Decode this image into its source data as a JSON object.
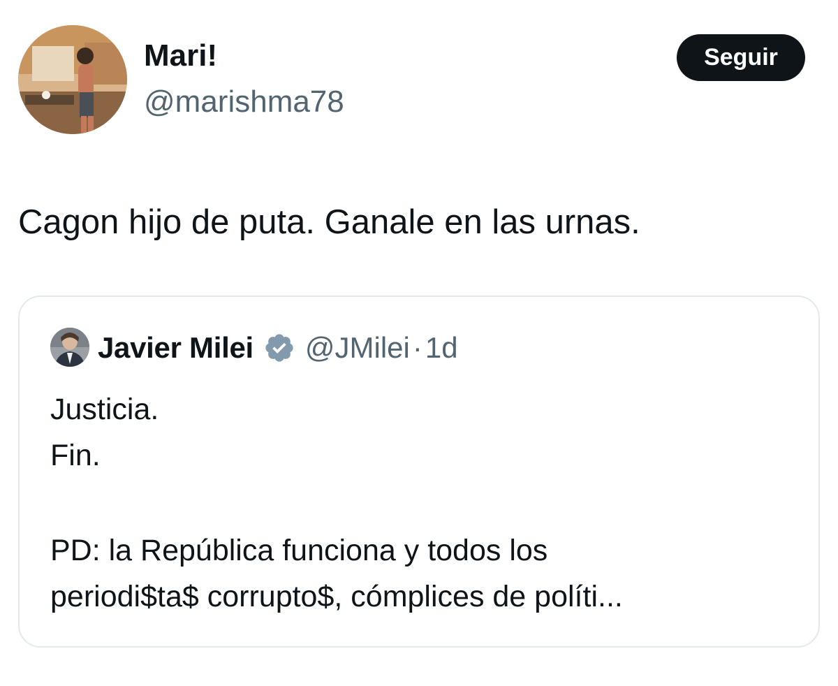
{
  "author": {
    "display_name": "Mari!",
    "handle": "@marishma78"
  },
  "follow_button": {
    "label": "Seguir"
  },
  "tweet": {
    "text": "Cagon hijo de puta. Ganale en las urnas."
  },
  "quoted_tweet": {
    "display_name": "Javier Milei",
    "verified_badge_icon": "verified-badge-icon",
    "handle": "@JMilei",
    "separator": "·",
    "time": "1d",
    "lines": [
      "Justicia.",
      "Fin.",
      "PD: la República funciona y todos los",
      "periodi$ta$ corrupto$, cómplices de políti..."
    ]
  },
  "colors": {
    "text_primary": "#0f1419",
    "text_secondary": "#536471",
    "follow_button_bg": "#0f1419",
    "card_border": "#e3e8ec",
    "badge": "#829aab"
  }
}
